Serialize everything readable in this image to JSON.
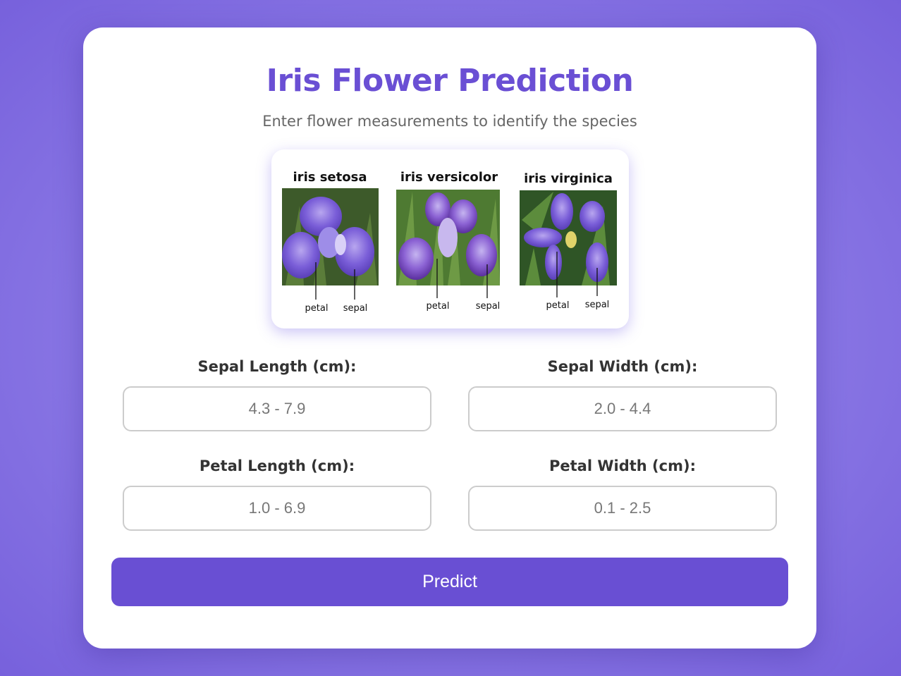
{
  "header": {
    "title": "Iris Flower Prediction",
    "subtitle": "Enter flower measurements to identify the species"
  },
  "species_image": {
    "species": [
      {
        "name": "iris setosa",
        "petal_label": "petal",
        "sepal_label": "sepal"
      },
      {
        "name": "iris versicolor",
        "petal_label": "petal",
        "sepal_label": "sepal"
      },
      {
        "name": "iris virginica",
        "petal_label": "petal",
        "sepal_label": "sepal"
      }
    ]
  },
  "form": {
    "sepal_length": {
      "label": "Sepal Length (cm):",
      "placeholder": "4.3 - 7.9",
      "value": ""
    },
    "sepal_width": {
      "label": "Sepal Width (cm):",
      "placeholder": "2.0 - 4.4",
      "value": ""
    },
    "petal_length": {
      "label": "Petal Length (cm):",
      "placeholder": "1.0 - 6.9",
      "value": ""
    },
    "petal_width": {
      "label": "Petal Width (cm):",
      "placeholder": "0.1 - 2.5",
      "value": ""
    },
    "submit_label": "Predict"
  },
  "colors": {
    "accent": "#694fd3",
    "title": "#6a4fd4",
    "background": "#8d7be6"
  }
}
